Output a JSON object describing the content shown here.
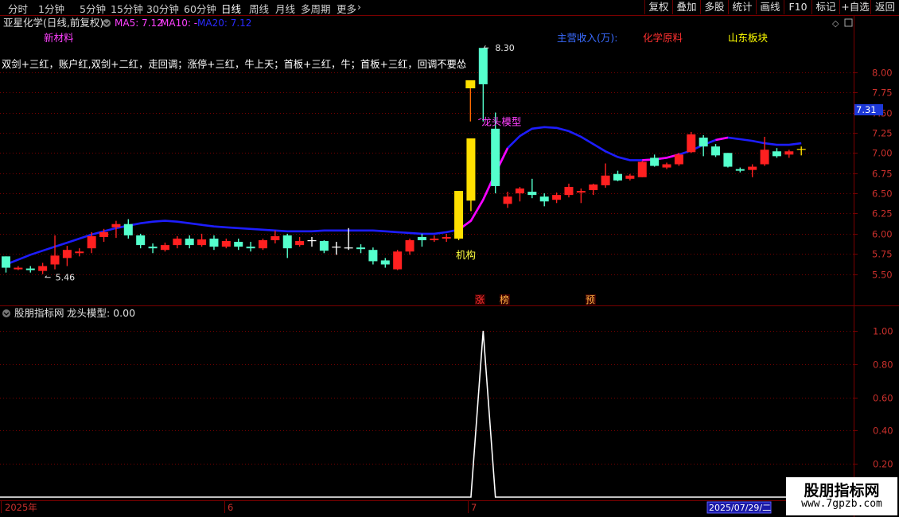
{
  "toolbar": {
    "periods": [
      "分时",
      "1分钟",
      "5分钟",
      "15分钟",
      "30分钟",
      "60分钟",
      "日线",
      "周线",
      "月线",
      "多周期",
      "更多"
    ],
    "more_arrow": "›",
    "active_period": "日线",
    "right_buttons": [
      "复权",
      "叠加",
      "多股",
      "统计",
      "画线",
      "F10",
      "标记",
      "+自选",
      "返回"
    ]
  },
  "main_panel": {
    "stock_title": "亚星化学(日线,前复权)",
    "ma5_label": "MA5: 7.12",
    "ma10_label": "MA10: -",
    "ma20_label": "MA20: 7.12",
    "tag_new_material": "新材料",
    "tag_main_revenue": "主营收入(万):",
    "tag_chem": "化学原料",
    "tag_shandong": "山东板块",
    "slogan": "双剑+三红，账户红,双剑+二红，走回调；涨停+三红，牛上天；首板+三红，牛；首板+三红，回调不要怂",
    "high_marker": "8.30",
    "low_marker": "5.46",
    "signal_label": "龙头模型",
    "institution_label": "机构",
    "flag_limit_up": "涨",
    "flag_list": "榜",
    "flag_forecast": "预",
    "current_price_tag": "7.31"
  },
  "sub_panel": {
    "title": "股朋指标网",
    "indicator_label": "龙头模型: 0.00"
  },
  "date_axis": {
    "labels": [
      "2025年",
      "6",
      "7"
    ],
    "cursor_date": "2025/07/29/二"
  },
  "watermark": {
    "line1": "股朋指标网",
    "line2": "www.7gpzb.com"
  },
  "colors": {
    "up": "#ff2020",
    "down": "#54ffcc",
    "ma20": "#1d1dff",
    "ma_pink": "#ff00ff",
    "limit_up": "#ffe000",
    "grid": "#7a0000",
    "axis_text": "#c9302c"
  },
  "chart_data": [
    {
      "type": "candlestick",
      "title": "亚星化学(日线,前复权)",
      "ylim": [
        5.3,
        8.45
      ],
      "y_ticks": [
        5.5,
        5.75,
        6.0,
        6.25,
        6.5,
        6.75,
        7.0,
        7.25,
        7.5,
        7.75,
        8.0
      ],
      "grid": true,
      "x_labels": [
        "2025年",
        "6",
        "7"
      ],
      "ohlc": [
        [
          5.72,
          5.58,
          5.72,
          5.52
        ],
        [
          5.56,
          5.58,
          5.6,
          5.55
        ],
        [
          5.57,
          5.55,
          5.6,
          5.52
        ],
        [
          5.54,
          5.6,
          5.64,
          5.5
        ],
        [
          5.62,
          5.73,
          5.98,
          5.56
        ],
        [
          5.7,
          5.8,
          5.85,
          5.6
        ],
        [
          5.76,
          5.78,
          5.82,
          5.72
        ],
        [
          5.82,
          5.97,
          6.02,
          5.76
        ],
        [
          5.96,
          6.02,
          6.06,
          5.9
        ],
        [
          6.08,
          6.12,
          6.16,
          5.95
        ],
        [
          6.12,
          5.98,
          6.18,
          5.94
        ],
        [
          5.98,
          5.86,
          6.0,
          5.82
        ],
        [
          5.84,
          5.82,
          5.88,
          5.76
        ],
        [
          5.8,
          5.86,
          5.89,
          5.78
        ],
        [
          5.86,
          5.94,
          5.97,
          5.82
        ],
        [
          5.94,
          5.86,
          5.98,
          5.82
        ],
        [
          5.86,
          5.93,
          6.0,
          5.84
        ],
        [
          5.94,
          5.84,
          5.98,
          5.8
        ],
        [
          5.84,
          5.91,
          5.94,
          5.82
        ],
        [
          5.9,
          5.84,
          5.94,
          5.8
        ],
        [
          5.84,
          5.82,
          5.9,
          5.78
        ],
        [
          5.82,
          5.92,
          5.94,
          5.8
        ],
        [
          5.92,
          5.97,
          6.04,
          5.88
        ],
        [
          5.98,
          5.82,
          6.0,
          5.7
        ],
        [
          5.86,
          5.91,
          5.96,
          5.84
        ],
        [
          5.92,
          5.92,
          5.96,
          5.84
        ],
        [
          5.91,
          5.79,
          5.92,
          5.76
        ],
        [
          5.84,
          5.83,
          5.9,
          5.74
        ],
        [
          5.82,
          5.83,
          6.07,
          5.8
        ],
        [
          5.83,
          5.81,
          5.87,
          5.76
        ],
        [
          5.8,
          5.66,
          5.83,
          5.62
        ],
        [
          5.67,
          5.62,
          5.7,
          5.58
        ],
        [
          5.56,
          5.78,
          5.8,
          5.55
        ],
        [
          5.78,
          5.92,
          5.94,
          5.74
        ],
        [
          5.96,
          5.92,
          6.0,
          5.84
        ],
        [
          5.92,
          5.94,
          5.98,
          5.9
        ],
        [
          5.94,
          5.96,
          6.0,
          5.9
        ],
        [
          5.94,
          6.53,
          6.53,
          5.92
        ],
        [
          6.41,
          7.18,
          7.18,
          6.28
        ],
        [
          8.3,
          7.85,
          8.3,
          7.39
        ],
        [
          7.3,
          6.59,
          7.5,
          6.5
        ],
        [
          6.37,
          6.46,
          6.52,
          6.32
        ],
        [
          6.5,
          6.56,
          6.58,
          6.4
        ],
        [
          6.52,
          6.48,
          6.68,
          6.44
        ],
        [
          6.46,
          6.4,
          6.5,
          6.34
        ],
        [
          6.42,
          6.48,
          6.51,
          6.38
        ],
        [
          6.48,
          6.58,
          6.62,
          6.45
        ],
        [
          6.51,
          6.53,
          6.56,
          6.38
        ],
        [
          6.54,
          6.61,
          6.62,
          6.48
        ],
        [
          6.6,
          6.72,
          6.87,
          6.57
        ],
        [
          6.74,
          6.66,
          6.78,
          6.65
        ],
        [
          6.68,
          6.72,
          6.74,
          6.66
        ],
        [
          6.7,
          6.89,
          6.9,
          6.7
        ],
        [
          6.94,
          6.84,
          6.98,
          6.83
        ],
        [
          6.82,
          6.86,
          6.88,
          6.8
        ],
        [
          6.86,
          6.98,
          7.0,
          6.84
        ],
        [
          7.01,
          7.23,
          7.26,
          7.0
        ],
        [
          7.19,
          7.08,
          7.22,
          6.96
        ],
        [
          7.08,
          6.97,
          7.11,
          6.95
        ],
        [
          7.0,
          6.83,
          7.0,
          6.82
        ],
        [
          6.8,
          6.78,
          6.82,
          6.76
        ],
        [
          6.79,
          6.83,
          6.86,
          6.7
        ],
        [
          6.86,
          7.04,
          7.2,
          6.84
        ],
        [
          7.02,
          6.96,
          7.06,
          6.94
        ],
        [
          6.98,
          7.02,
          7.04,
          6.94
        ],
        [
          7.05,
          7.04,
          7.08,
          6.97
        ]
      ],
      "ma20": [
        5.62,
        5.68,
        5.74,
        5.79,
        5.84,
        5.89,
        5.94,
        5.99,
        6.03,
        6.07,
        6.1,
        6.13,
        6.15,
        6.16,
        6.15,
        6.13,
        6.11,
        6.09,
        6.08,
        6.07,
        6.06,
        6.05,
        6.04,
        6.03,
        6.03,
        6.03,
        6.04,
        6.04,
        6.04,
        6.04,
        6.04,
        6.03,
        6.02,
        6.01,
        6.0,
        6.0,
        6.02,
        6.05,
        6.16,
        6.42,
        6.75,
        7.06,
        7.21,
        7.3,
        7.32,
        7.31,
        7.27,
        7.2,
        7.11,
        7.02,
        6.95,
        6.91,
        6.91,
        6.92,
        6.94,
        6.98,
        7.03,
        7.1,
        7.16,
        7.19,
        7.17,
        7.15,
        7.12,
        7.1,
        7.1,
        7.12
      ],
      "ma20_pink_segments": [
        [
          37,
          41
        ],
        [
          52,
          55
        ],
        [
          58,
          59
        ]
      ]
    },
    {
      "type": "line",
      "title": "龙头模型",
      "ylim": [
        0.0,
        1.1
      ],
      "y_ticks": [
        0.2,
        0.4,
        0.6,
        0.8,
        1.0
      ],
      "signal_index": 39,
      "signal_value": 1.0,
      "baseline_value": 0.0,
      "signal_width_bars": 1
    }
  ]
}
